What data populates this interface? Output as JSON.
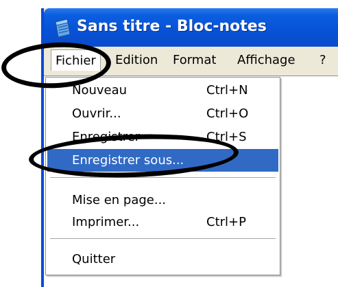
{
  "window": {
    "title": "Sans titre - Bloc-notes",
    "icon": "notepad-icon",
    "titlebar_color": "#0851d6"
  },
  "menubar": {
    "items": [
      {
        "label": "Fichier",
        "active": true
      },
      {
        "label": "Edition"
      },
      {
        "label": "Format"
      },
      {
        "label": "Affichage"
      },
      {
        "label": "?"
      }
    ]
  },
  "file_menu": {
    "items": [
      {
        "label": "Nouveau",
        "shortcut": "Ctrl+N"
      },
      {
        "label": "Ouvrir...",
        "shortcut": "Ctrl+O"
      },
      {
        "label": "Enregistrer",
        "shortcut": "Ctrl+S"
      },
      {
        "label": "Enregistrer sous...",
        "shortcut": "",
        "highlighted": true
      },
      {
        "label": "Mise en page...",
        "shortcut": ""
      },
      {
        "label": "Imprimer...",
        "shortcut": "Ctrl+P"
      },
      {
        "label": "Quitter",
        "shortcut": ""
      }
    ],
    "highlight_color": "#316ac5"
  },
  "annotations": {
    "oval_color": "#000000",
    "circled_items": [
      "Fichier",
      "Enregistrer sous..."
    ]
  }
}
